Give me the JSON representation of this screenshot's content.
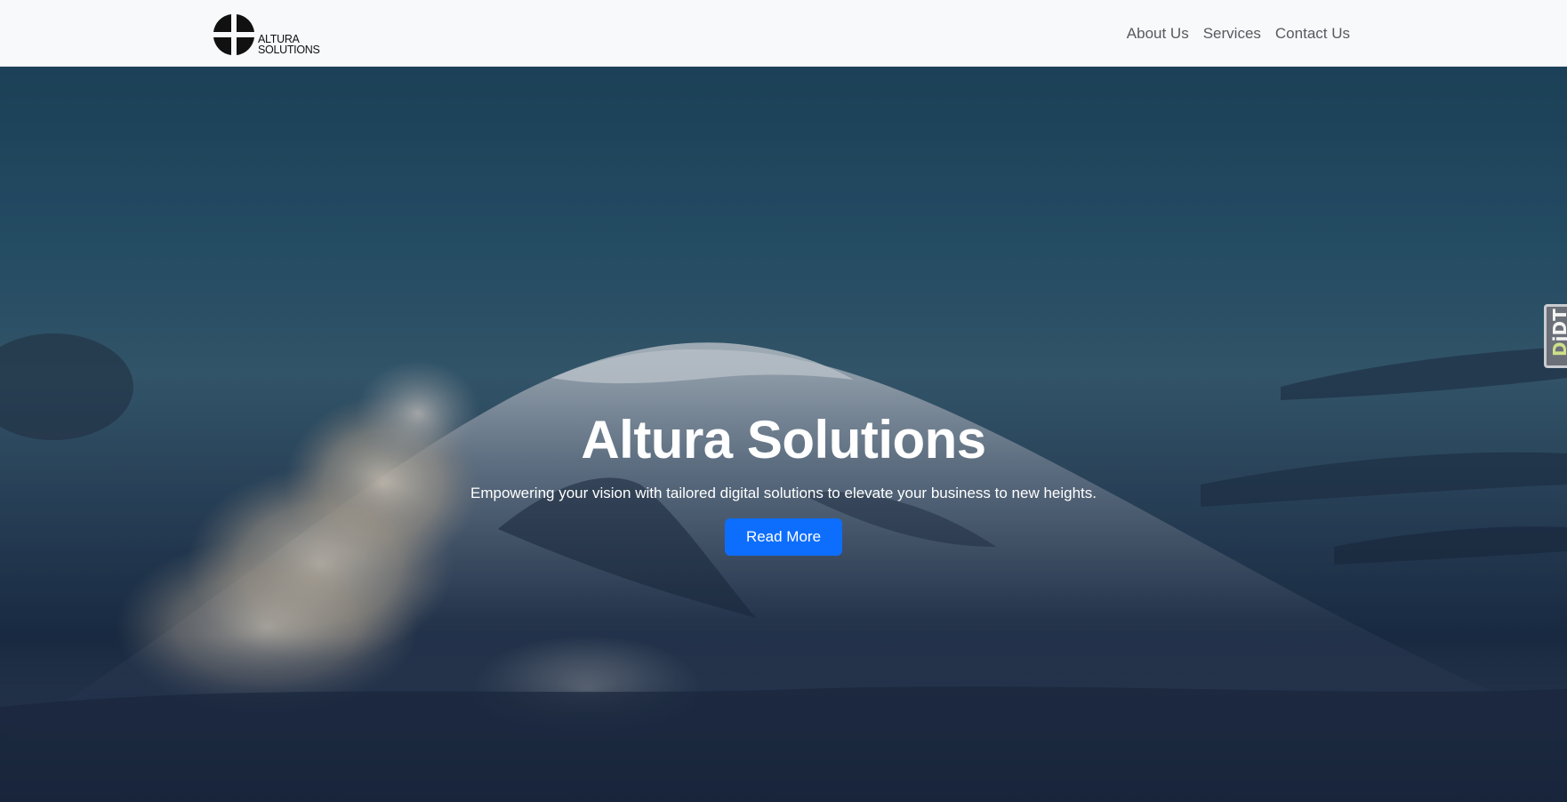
{
  "navbar": {
    "brand": {
      "line1": "ALTURA",
      "line2": "SOLUTIONS",
      "logo_icon": "quartered-circle-logo"
    },
    "links": [
      {
        "label": "About Us"
      },
      {
        "label": "Services"
      },
      {
        "label": "Contact Us"
      }
    ]
  },
  "hero": {
    "title": "Altura Solutions",
    "subtitle": "Empowering your vision with tailored digital solutions to elevate your business to new heights.",
    "cta_label": "Read More",
    "background": "snow-capped-mountain-with-clouds"
  },
  "side_tab": {
    "text_accent": "D",
    "text_rest": "jDT"
  },
  "colors": {
    "navbar_bg": "#f8f9fa",
    "nav_link": "#555a60",
    "primary_button": "#0d6efd",
    "hero_text": "#ffffff"
  }
}
